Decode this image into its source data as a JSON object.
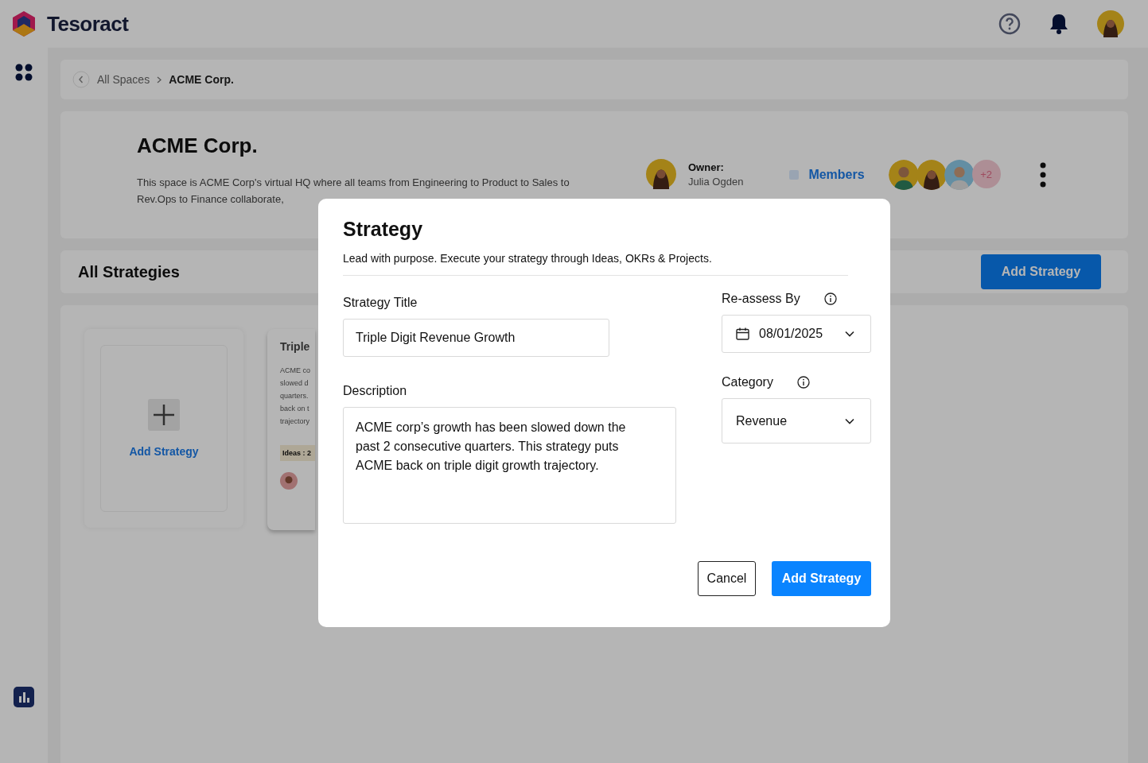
{
  "app": {
    "name": "Tesoract"
  },
  "breadcrumb": {
    "items": [
      {
        "label": "All Spaces",
        "selected": false
      },
      {
        "label": "ACME Corp.",
        "selected": true
      }
    ]
  },
  "space": {
    "title": "ACME Corp.",
    "description": "This space is ACME Corp's virtual HQ where all teams from Engineering to Product to Sales to Rev.Ops to Finance collaborate,",
    "owner_label": "Owner:",
    "owner_name": "Julia Ogden",
    "members_label": "Members",
    "extra_members": "+2"
  },
  "strategies": {
    "title": "All Strategies",
    "add_button": "Add Strategy",
    "add_card_label": "Add Strategy",
    "card": {
      "title": "Triple",
      "lines": [
        "ACME co",
        "slowed d",
        "quarters.",
        "back on t",
        "trajectory"
      ],
      "tag": "Ideas : 2"
    }
  },
  "modal": {
    "title": "Strategy",
    "subtitle": "Lead with purpose. Execute your strategy through Ideas, OKRs & Projects.",
    "fields": [
      {
        "label": "Strategy Title",
        "value": "Triple Digit Revenue Growth"
      },
      {
        "label": "Description",
        "value": "ACME corp’s growth has been slowed down the past 2 consecutive quarters. This strategy puts ACME back on triple digit growth trajectory."
      },
      {
        "label": "Re-assess By",
        "value": "08/01/2025"
      },
      {
        "label": "Category",
        "value": "Revenue"
      }
    ],
    "buttons": [
      {
        "label": "Cancel",
        "kind": "secondary"
      },
      {
        "label": "Add Strategy",
        "kind": "primary"
      }
    ]
  }
}
